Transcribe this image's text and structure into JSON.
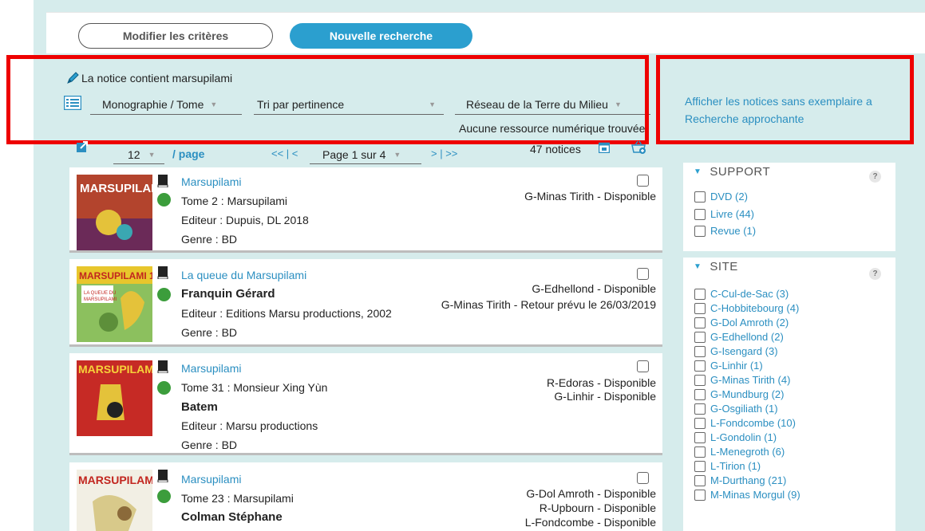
{
  "actions": {
    "modify_label": "Modifier les critères",
    "new_search_label": "Nouvelle recherche"
  },
  "criteria": {
    "text": "La notice contient marsupilami"
  },
  "filters": {
    "doc_type": "Monographie / Tome",
    "sort": "Tri par pertinence",
    "network": "Réseau de la Terre du Milieu",
    "no_digital": "Aucune ressource numérique trouvée"
  },
  "side_links": {
    "no_copy": "Afficher les notices sans exemplaire a",
    "approx": "Recherche approchante"
  },
  "pagination": {
    "per_page_value": "12",
    "per_page_label": "/ page",
    "first_prev": "<< | <",
    "page_value": "Page 1 sur 4",
    "next_last": "> | >>",
    "count": "47 notices"
  },
  "results": [
    {
      "title": "Marsupilami",
      "lines": [
        "Tome 2 : Marsupilami",
        "Editeur : Dupuis, DL 2018",
        "Genre :  BD"
      ],
      "bold_line": "",
      "availability": [
        "G-Minas Tirith - Disponible"
      ]
    },
    {
      "title": "La queue du Marsupilami",
      "lines": [
        "Franquin Gérard",
        "Editeur : Editions Marsu productions, 2002",
        "Genre :  BD"
      ],
      "bold_line": "Franquin Gérard",
      "availability": [
        "G-Edhellond - Disponible",
        "G-Minas Tirith - Retour prévu le 26/03/2019"
      ]
    },
    {
      "title": "Marsupilami",
      "lines": [
        "Tome 31 : Monsieur Xing Yùn",
        "Batem",
        "Editeur :  Marsu productions",
        "Genre :  BD"
      ],
      "bold_line": "Batem",
      "availability": [
        "R-Edoras - Disponible",
        "G-Linhir - Disponible"
      ]
    },
    {
      "title": "Marsupilami",
      "lines": [
        "Tome 23 : Marsupilami",
        "Colman Stéphane"
      ],
      "bold_line": "Colman Stéphane",
      "availability": [
        "G-Dol Amroth - Disponible",
        "R-Upbourn - Disponible",
        "L-Fondcombe - Disponible"
      ]
    }
  ],
  "facets": {
    "support": {
      "title": "SUPPORT",
      "help": "?",
      "options": [
        "DVD (2)",
        "Livre (44)",
        "Revue (1)"
      ]
    },
    "site": {
      "title": "SITE",
      "help": "?",
      "options": [
        "C-Cul-de-Sac (3)",
        "C-Hobbitebourg (4)",
        "G-Dol Amroth (2)",
        "G-Edhellond (2)",
        "G-Isengard (3)",
        "G-Linhir (1)",
        "G-Minas Tirith (4)",
        "G-Mundburg (2)",
        "G-Osgiliath (1)",
        "L-Fondcombe (10)",
        "L-Gondolin (1)",
        "L-Menegroth (6)",
        "L-Tirion (1)",
        "M-Durthang (21)",
        "M-Minas Morgul (9)"
      ]
    }
  },
  "colors": {
    "accent": "#2b9fcf",
    "link": "#2b8fc1",
    "background": "#d6ecec",
    "highlight_box": "#ee0000",
    "available": "#3c9d3c"
  }
}
